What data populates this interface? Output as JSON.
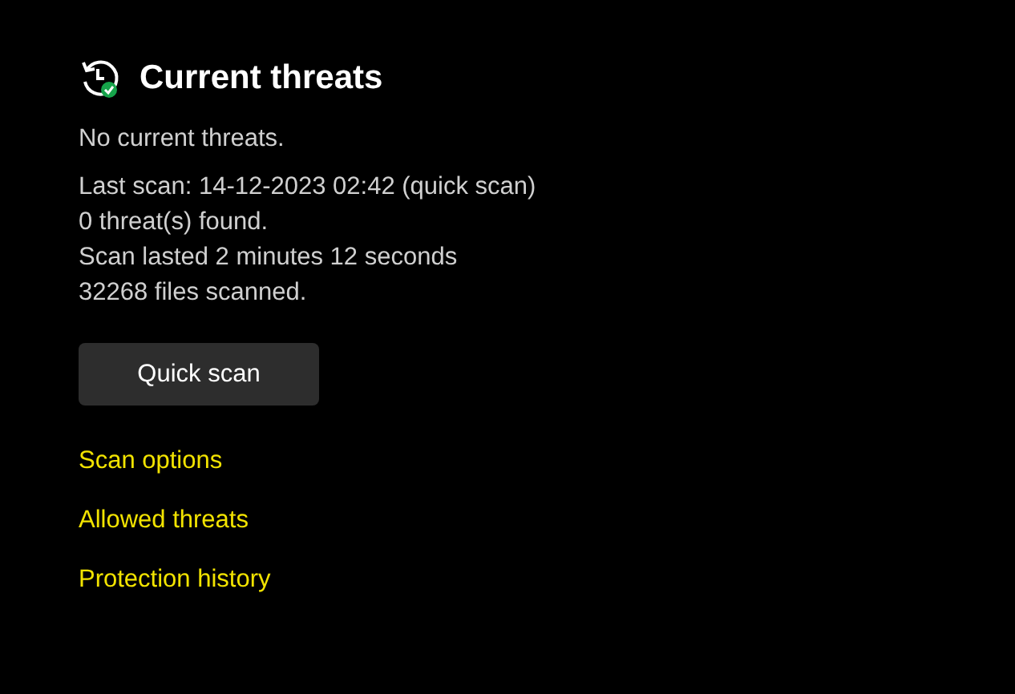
{
  "section": {
    "title": "Current threats"
  },
  "status": "No current threats.",
  "details": [
    "Last scan: 14-12-2023 02:42 (quick scan)",
    "0 threat(s) found.",
    "Scan lasted 2 minutes 12 seconds",
    "32268 files scanned."
  ],
  "button": "Quick scan",
  "links": [
    "Scan options",
    "Allowed threats",
    "Protection history"
  ]
}
